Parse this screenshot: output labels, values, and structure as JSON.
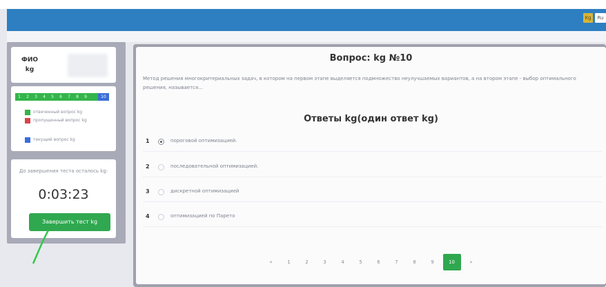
{
  "header": {
    "lang_kg": "Kg",
    "lang_ru": "Ru"
  },
  "sidebar": {
    "fio_label_line1": "ФИО",
    "fio_label_line2": "kg",
    "question_numbers": [
      "1",
      "2",
      "3",
      "4",
      "5",
      "6",
      "7",
      "8",
      "9",
      "10"
    ],
    "current_question": "10",
    "legend": {
      "answered": "отвеченный вопрос kg",
      "skipped": "пропущенный вопрос kg",
      "current": "текущий вопрос kg"
    },
    "timer_label": "До завершения теста осталось kg:",
    "timer_value": "0:03:23",
    "finish_button": "Завершить тест kg"
  },
  "question": {
    "title": "Вопрос: kg №10",
    "text": "Метод решения многокритериальных задач, в котором на первом этапе выделяется подмножество неулучшаемых вариантов, а на втором этапе - выбор оптимального решения, называется...",
    "answers_title": "Ответы kg(один ответ kg)",
    "answers": [
      {
        "num": "1",
        "text": "пороговой оптимизацией.",
        "checked": true
      },
      {
        "num": "2",
        "text": "последовательной оптимизацией.",
        "checked": false
      },
      {
        "num": "3",
        "text": "дискретной оптимизацией",
        "checked": false
      },
      {
        "num": "4",
        "text": "оптимизацией по Парето",
        "checked": false
      }
    ]
  },
  "pagination": {
    "prev": "«",
    "pages": [
      "1",
      "2",
      "3",
      "4",
      "5",
      "6",
      "7",
      "8",
      "9",
      "10"
    ],
    "active": "10",
    "next": "»"
  },
  "colors": {
    "topbar": "#2d7fc1",
    "answered": "#34b54b",
    "skipped": "#d9434b",
    "current": "#3a6fd8",
    "finish_button": "#2fa84f"
  }
}
